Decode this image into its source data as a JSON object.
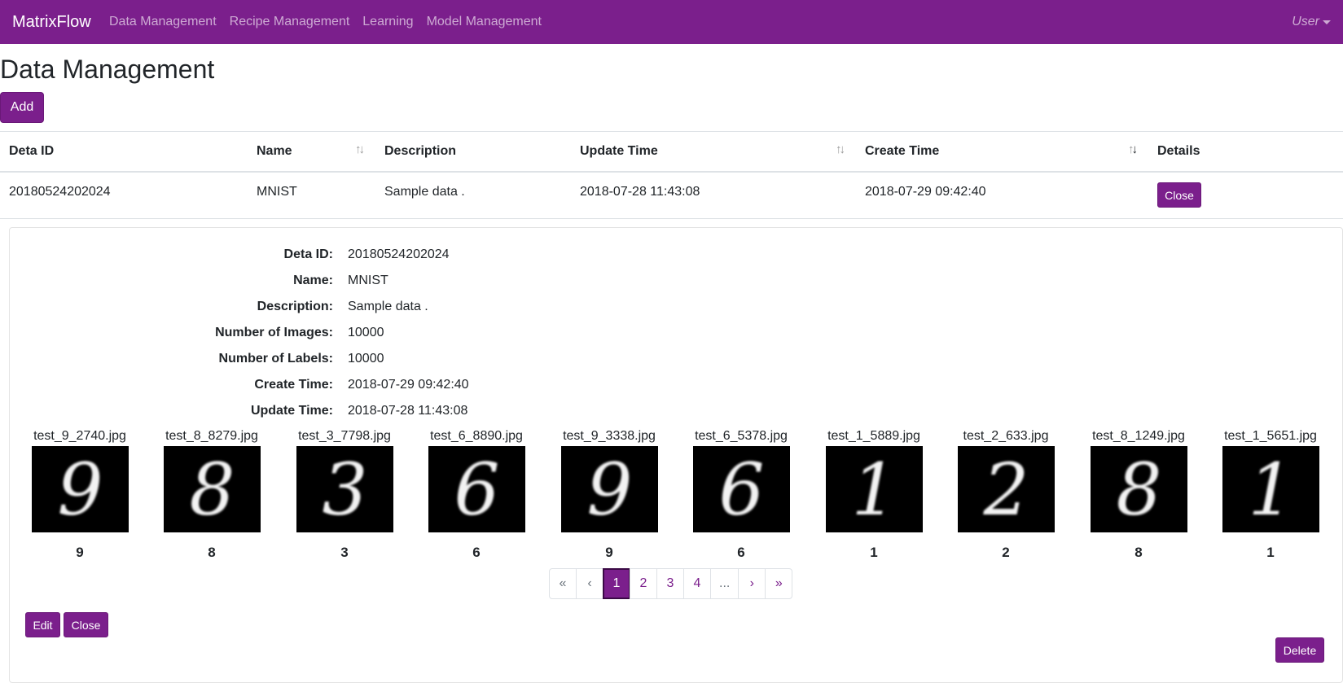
{
  "navbar": {
    "brand": "MatrixFlow",
    "links": [
      "Data Management",
      "Recipe Management",
      "Learning",
      "Model Management"
    ],
    "user": "User"
  },
  "page": {
    "title": "Data Management",
    "add_label": "Add"
  },
  "table": {
    "headers": [
      "Deta ID",
      "Name",
      "Description",
      "Update Time",
      "Create Time",
      "Details"
    ],
    "row": {
      "id": "20180524202024",
      "name": "MNIST",
      "description": "Sample data .",
      "update_time": "2018-07-28 11:43:08",
      "create_time": "2018-07-29 09:42:40",
      "close_label": "Close"
    }
  },
  "details": {
    "fields": [
      {
        "label": "Deta ID:",
        "value": "20180524202024"
      },
      {
        "label": "Name:",
        "value": "MNIST"
      },
      {
        "label": "Description:",
        "value": "Sample data ."
      },
      {
        "label": "Number of Images:",
        "value": "10000"
      },
      {
        "label": "Number of Labels:",
        "value": "10000"
      },
      {
        "label": "Create Time:",
        "value": "2018-07-29 09:42:40"
      },
      {
        "label": "Update Time:",
        "value": "2018-07-28 11:43:08"
      }
    ],
    "images": [
      {
        "file": "test_9_2740.jpg",
        "label": "9"
      },
      {
        "file": "test_8_8279.jpg",
        "label": "8"
      },
      {
        "file": "test_3_7798.jpg",
        "label": "3"
      },
      {
        "file": "test_6_8890.jpg",
        "label": "6"
      },
      {
        "file": "test_9_3338.jpg",
        "label": "9"
      },
      {
        "file": "test_6_5378.jpg",
        "label": "6"
      },
      {
        "file": "test_1_5889.jpg",
        "label": "1"
      },
      {
        "file": "test_2_633.jpg",
        "label": "2"
      },
      {
        "file": "test_8_1249.jpg",
        "label": "8"
      },
      {
        "file": "test_1_5651.jpg",
        "label": "1"
      }
    ],
    "pagination": [
      "«",
      "‹",
      "1",
      "2",
      "3",
      "4",
      "...",
      "›",
      "»"
    ],
    "current_page": "1",
    "edit_label": "Edit",
    "close_label": "Close",
    "delete_label": "Delete"
  },
  "colors": {
    "brand": "#7b1f8c",
    "nav_text": "rgba(255,255,255,0.62)",
    "border": "#dee2e6"
  }
}
